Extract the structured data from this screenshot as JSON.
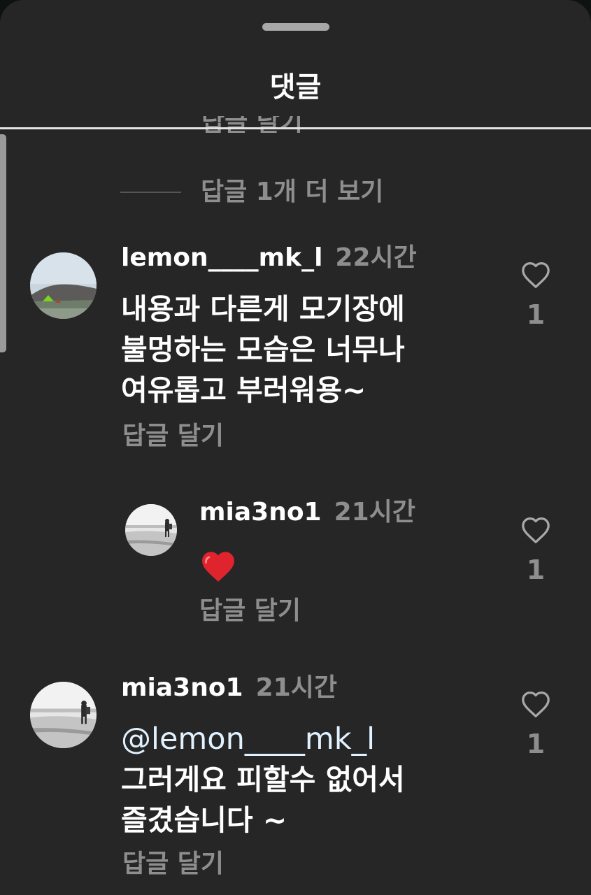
{
  "sheet": {
    "title": "댓글",
    "clipped_reply_label": "답글 달기",
    "view_more_replies": "답글 1개 더 보기"
  },
  "comments": [
    {
      "username": "lemon____mk_l",
      "time": "22시간",
      "lines": [
        "내용과 다른게 모기장에",
        "불멍하는 모습은 너무나",
        "여유롭고 부러워용~"
      ],
      "reply_label": "답글 달기",
      "likes": "1",
      "avatar_icon": "landscape-tent-avatar"
    },
    {
      "username": "mia3no1",
      "time": "21시간",
      "emoji": "red-heart-emoji",
      "reply_label": "답글 달기",
      "likes": "1",
      "avatar_icon": "beach-hiker-avatar"
    },
    {
      "username": "mia3no1",
      "time": "21시간",
      "mention": "@lemon____mk_l",
      "lines": [
        "그러게요 피할수 없어서",
        "즐겼습니다 ~"
      ],
      "reply_label": "답글 달기",
      "likes": "1",
      "avatar_icon": "beach-hiker-avatar"
    }
  ],
  "colors": {
    "sheet_background": "#262626",
    "primary_text": "#ffffff",
    "secondary_text": "#8e8e8e",
    "mention_text": "#e0f1ff",
    "heart_emoji": "#e0242e"
  },
  "icons": {
    "like": "heart-outline-icon"
  }
}
